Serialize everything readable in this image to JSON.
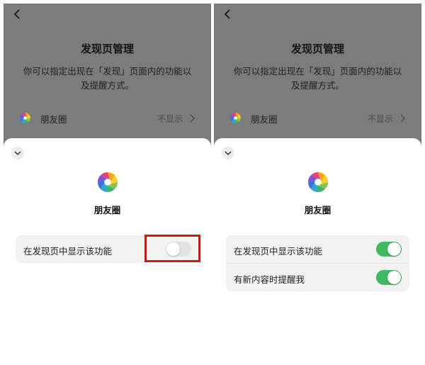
{
  "colors": {
    "toggle_on": "#41b862",
    "toggle_off": "#e3e3e3",
    "highlight": "#b3231f",
    "dimmed_background": "#7c7c7c"
  },
  "panels": [
    {
      "page_title": "发现页管理",
      "description": "你可以指定出现在「发现」页面内的功能以及提醒方式。",
      "moments_label": "朋友圈",
      "moments_status": "不显示",
      "sheet": {
        "feature_name": "朋友圈",
        "settings": [
          {
            "label": "在发现页中显示该功能",
            "enabled": false,
            "highlighted": true
          }
        ]
      }
    },
    {
      "page_title": "发现页管理",
      "description": "你可以指定出现在「发现」页面内的功能以及提醒方式。",
      "moments_label": "朋友圈",
      "moments_status": "不显示",
      "sheet": {
        "feature_name": "朋友圈",
        "settings": [
          {
            "label": "在发现页中显示该功能",
            "enabled": true
          },
          {
            "label": "有新内容时提醒我",
            "enabled": true
          }
        ]
      }
    }
  ],
  "icons": {
    "back": "back-chevron-icon",
    "moments": "moments-aperture-icon",
    "collapse": "chevron-down-icon",
    "arrow": "chevron-right-icon"
  }
}
